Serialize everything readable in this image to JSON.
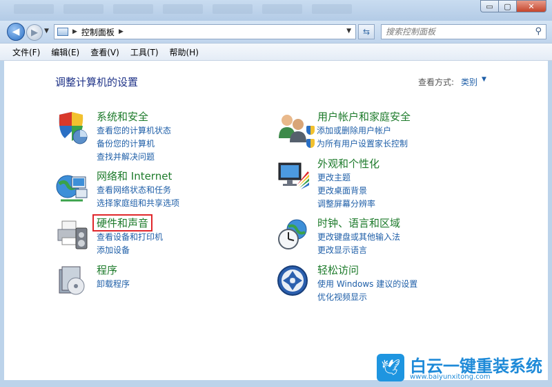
{
  "window": {
    "minimize_glyph": "▭",
    "maximize_glyph": "▢",
    "close_glyph": "✕"
  },
  "address_bar": {
    "path": "控制面板",
    "search_placeholder": "搜索控制面板"
  },
  "menu": [
    "文件(F)",
    "编辑(E)",
    "查看(V)",
    "工具(T)",
    "帮助(H)"
  ],
  "main": {
    "heading": "调整计算机的设置",
    "view_by_label": "查看方式:",
    "view_by_value": "类别"
  },
  "categories": {
    "system_security": {
      "title": "系统和安全",
      "icon": "shield-chart-icon",
      "links": [
        "查看您的计算机状态",
        "备份您的计算机",
        "查找并解决问题"
      ]
    },
    "network": {
      "title": "网络和 Internet",
      "icon": "globe-network-icon",
      "links": [
        "查看网络状态和任务",
        "选择家庭组和共享选项"
      ]
    },
    "hardware_sound": {
      "title": "硬件和声音",
      "icon": "printer-speaker-icon",
      "links": [
        "查看设备和打印机",
        "添加设备"
      ]
    },
    "programs": {
      "title": "程序",
      "icon": "programs-disc-icon",
      "links": [
        "卸载程序"
      ]
    },
    "user_accounts": {
      "title": "用户帐户和家庭安全",
      "icon": "users-icon",
      "links": [
        "添加或删除用户帐户",
        "为所有用户设置家长控制"
      ]
    },
    "appearance": {
      "title": "外观和个性化",
      "icon": "monitor-palette-icon",
      "links": [
        "更改主题",
        "更改桌面背景",
        "调整屏幕分辨率"
      ]
    },
    "clock_region": {
      "title": "时钟、语言和区域",
      "icon": "clock-globe-icon",
      "links": [
        "更改键盘或其他输入法",
        "更改显示语言"
      ]
    },
    "ease_access": {
      "title": "轻松访问",
      "icon": "ease-of-access-icon",
      "links": [
        "使用 Windows 建议的设置",
        "优化视频显示"
      ]
    }
  },
  "watermark": {
    "text": "白云一键重装系统",
    "url": "www.baiyunxitong.com"
  },
  "colors": {
    "link": "#1f5fa8",
    "category_title": "#1c7a2a",
    "highlight_box": "#e0262a",
    "heading": "#1e3287"
  }
}
